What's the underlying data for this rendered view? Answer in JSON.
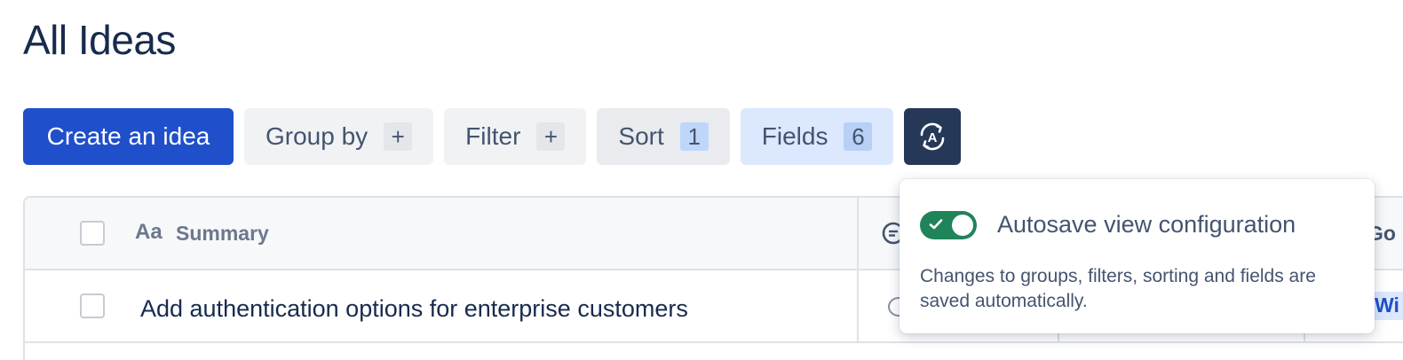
{
  "page": {
    "title": "All Ideas"
  },
  "toolbar": {
    "create_label": "Create an idea",
    "group_by_label": "Group by",
    "group_by_icon": "+",
    "filter_label": "Filter",
    "filter_icon": "+",
    "sort_label": "Sort",
    "sort_count": "1",
    "fields_label": "Fields",
    "fields_count": "6",
    "autosave_icon": "autosave-icon"
  },
  "table": {
    "headers": {
      "summary_icon": "Aa",
      "summary": "Summary",
      "partial_col": "Go"
    },
    "rows": [
      {
        "summary": "Add authentication options for enterprise customers",
        "partial_badge": "Wi"
      }
    ]
  },
  "popup": {
    "toggle_on": true,
    "title": "Autosave view configuration",
    "description": "Changes to groups, filters, sorting and fields are saved automatically."
  },
  "colors": {
    "primary": "#1f4fca",
    "toggle_on": "#1f845a",
    "autosave_button": "#253858",
    "fields_bg": "#dbe8fe"
  }
}
